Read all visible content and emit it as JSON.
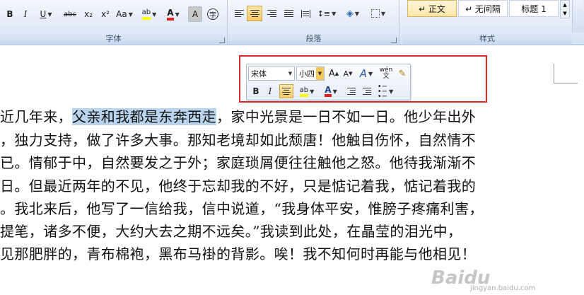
{
  "ribbon": {
    "font_group": {
      "label": "字体",
      "bold": "B",
      "italic": "I",
      "underline": "U",
      "strike": "abc",
      "subscript": "x₂",
      "superscript": "x²",
      "change_case": "Aa",
      "highlight": "ab",
      "font_color": "A",
      "char_shading": "A",
      "enclose": "字"
    },
    "para_group": {
      "label": "段落"
    },
    "styles_group": {
      "label": "样式",
      "styles": [
        "↵ 正文",
        "↵ 无间隔",
        "标题 1"
      ]
    }
  },
  "mini_toolbar": {
    "font_name": "宋体",
    "font_size": "小四",
    "grow_font": "A",
    "shrink_font": "A",
    "styles": "A",
    "phonetic": "wén",
    "bold": "B",
    "italic": "I",
    "highlight": "ab",
    "font_color": "A"
  },
  "document": {
    "lines": [
      {
        "before": "近几年来，",
        "highlight": "父亲和我都是东奔西走",
        "after": "，家中光景是一日不如一日。他少年出外"
      },
      {
        "before": "，独力支持，做了许多大事。那知老境却如此颓唐！他触目伤怀，自然情不",
        "highlight": "",
        "after": ""
      },
      {
        "before": "已。情郁于中，自然要发之于外；家庭琐屑便往往触他之怒。他待我渐渐不",
        "highlight": "",
        "after": ""
      },
      {
        "before": "日。但最近两年的不见，他终于忘却我的不好，只是惦记着我，惦记着我的",
        "highlight": "",
        "after": ""
      },
      {
        "before": "。我北来后，他写了一信给我，信中说道，“我身体平安，惟膀子疼痛利害，",
        "highlight": "",
        "after": ""
      },
      {
        "before": "提笔，诸多不便，大约大去之期不远矣。”我读到此处，在晶莹的泪光中，",
        "highlight": "",
        "after": ""
      },
      {
        "before": "见那肥胖的，青布棉袍，黑布马褂的背影。唉！我不知何时再能与他相见！",
        "highlight": "",
        "after": ""
      }
    ]
  },
  "watermark": {
    "logo": "Baidu",
    "url": "jingyan.baidu.com"
  },
  "colors": {
    "selection": "#b9d4ee",
    "frame": "#e0282c",
    "highlight_yellow": "#ffff00",
    "font_red": "#e02020"
  }
}
